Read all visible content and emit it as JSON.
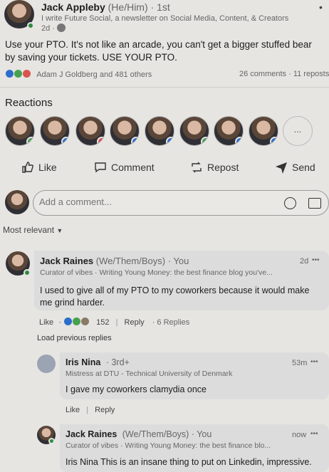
{
  "post": {
    "author_name": "Jack Appleby",
    "author_pronouns": "(He/Him)",
    "author_degree": "· 1st",
    "author_tagline": "I write Future Social, a newsletter on Social Media, Content, & Creators",
    "age": "2d ·",
    "text": "Use your PTO. It's not like an arcade, you can't get a bigger stuffed bear by saving your tickets. USE YOUR PTO.",
    "reactions_summary": "Adam J Goldberg and 481 others",
    "comments_count": "26 comments",
    "reposts_count": "· 11 reposts"
  },
  "reactions": {
    "heading": "Reactions",
    "more_label": "..."
  },
  "actions": {
    "like": "Like",
    "comment": "Comment",
    "repost": "Repost",
    "send": "Send"
  },
  "composer": {
    "placeholder": "Add a comment..."
  },
  "sort": {
    "label": "Most relevant"
  },
  "comments": [
    {
      "name": "Jack Raines",
      "pronouns": "(We/Them/Boys)",
      "degree": "· You",
      "tagline": "Curator of vibes · Writing Young Money: the best finance blog you've...",
      "age": "2d",
      "more": "•••",
      "text": "I used to give all of my PTO to my coworkers because it would make me grind harder.",
      "like": "Like",
      "react_count": "152",
      "reply": "Reply",
      "replies": "· 6 Replies"
    }
  ],
  "load_previous": "Load previous replies",
  "replies": [
    {
      "name": "Iris Nina",
      "degree": "· 3rd+",
      "tagline": "Mistress at DTU - Technical University of Denmark",
      "age": "53m",
      "more": "•••",
      "text": "I gave my coworkers clamydia once",
      "like": "Like",
      "reply": "Reply"
    },
    {
      "name": "Jack Raines",
      "pronouns": "(We/Them/Boys)",
      "degree": "· You",
      "tagline": "Curator of vibes · Writing Young Money: the best finance blo...",
      "age": "now",
      "more": "•••",
      "text": "Iris Nina This is an insane thing to put on Linkedin, impressive."
    }
  ],
  "colors": {
    "background": "#e6e5e2",
    "comment_bg": "#dcdcdc",
    "link_blue": "#2c6ecb",
    "online_green": "#2f8a3d"
  }
}
